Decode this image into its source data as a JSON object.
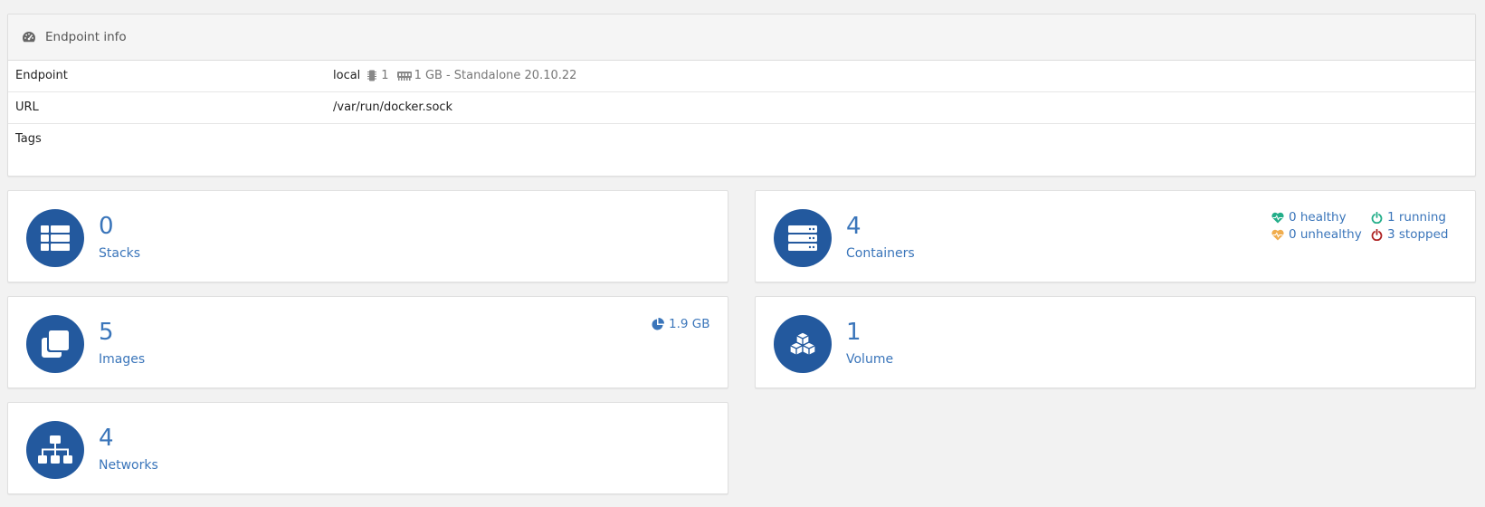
{
  "endpoint_info": {
    "title": "Endpoint info",
    "rows": {
      "endpoint": {
        "key": "Endpoint",
        "name": "local",
        "cpu": "1",
        "memory": "1 GB",
        "details": "- Standalone 20.10.22"
      },
      "url": {
        "key": "URL",
        "value": "/var/run/docker.sock"
      },
      "tags": {
        "key": "Tags",
        "value": ""
      }
    }
  },
  "tiles": {
    "stacks": {
      "count": "0",
      "label": "Stacks",
      "icon": "table-list-icon"
    },
    "containers": {
      "count": "4",
      "label": "Containers",
      "icon": "server-icon",
      "healthy": "0 healthy",
      "unhealthy": "0 unhealthy",
      "running": "1 running",
      "stopped": "3 stopped"
    },
    "images": {
      "count": "5",
      "label": "Images",
      "icon": "clone-icon",
      "size": "1.9 GB"
    },
    "volumes": {
      "count": "1",
      "label": "Volume",
      "icon": "cubes-icon"
    },
    "networks": {
      "count": "4",
      "label": "Networks",
      "icon": "sitemap-icon"
    }
  },
  "colors": {
    "accent": "#3a75ba",
    "icon_circle": "#23599e",
    "healthy": "#23ae89",
    "unhealthy": "#f0ad4e",
    "stopped": "#ae2323"
  }
}
